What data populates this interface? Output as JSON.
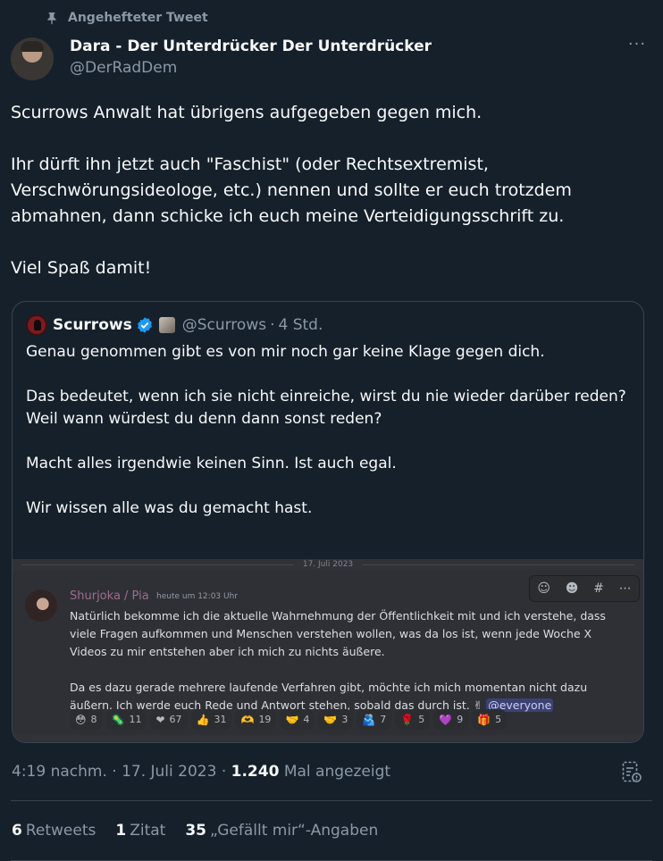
{
  "pinned_label": "Angehefteter Tweet",
  "author": {
    "name": "Dara - Der Unterdrücker Der Unterdrücker",
    "handle": "@DerRadDem"
  },
  "tweet_paragraphs": [
    "Scurrows Anwalt hat übrigens aufgegeben gegen mich.",
    "Ihr dürft ihn jetzt auch \"Faschist\" (oder Rechtsextremist, Verschwörungsideologe, etc.) nennen und sollte er euch trotzdem abmahnen, dann schicke ich euch meine Verteidigungsschrift zu.",
    "Viel Spaß damit!"
  ],
  "quote": {
    "name": "Scurrows",
    "handle": "@Scurrows",
    "separator": "·",
    "time": "4 Std.",
    "paragraphs": [
      "Genau genommen gibt es von mir noch gar keine Klage gegen dich.",
      "Das bedeutet, wenn ich sie nicht einreiche, wirst du nie wieder darüber reden? Weil wann würdest du denn dann sonst reden?",
      "Macht alles irgendwie keinen Sinn. Ist auch egal.",
      "Wir wissen alle was du gemacht hast."
    ],
    "image": {
      "date": "17. Juli 2023",
      "author": "Shurjoka / Pia",
      "timestamp": "heute um 12:03 Uhr",
      "paragraphs": [
        "Natürlich bekomme ich die aktuelle Wahrnehmung der Öffentlichkeit mit und ich verstehe, dass viele Fragen aufkommen und Menschen verstehen wollen, was da los ist, wenn jede Woche X Videos zu mir entstehen aber ich mich zu nichts äußere.",
        "Da es dazu gerade mehrere laufende Verfahren gibt, möchte ich mich momentan nicht dazu äußern. Ich werde euch Rede und Antwort stehen, sobald das durch ist. ✌"
      ],
      "mention": "@everyone",
      "reactions": [
        {
          "emoji": "😳",
          "count": "8"
        },
        {
          "emoji": "🦠",
          "count": "11"
        },
        {
          "emoji": "❤",
          "count": "67"
        },
        {
          "emoji": "👍",
          "count": "31"
        },
        {
          "emoji": "🫶",
          "count": "19"
        },
        {
          "emoji": "🤝",
          "count": "4"
        },
        {
          "emoji": "🤝",
          "count": "3"
        },
        {
          "emoji": "🫂",
          "count": "7"
        },
        {
          "emoji": "🌹",
          "count": "5"
        },
        {
          "emoji": "💜",
          "count": "9"
        },
        {
          "emoji": "🎁",
          "count": "5"
        }
      ]
    }
  },
  "meta": {
    "time": "4:19 nachm.",
    "dot": "·",
    "date": "17. Juli 2023",
    "views": "1.240",
    "views_label": "Mal angezeigt"
  },
  "stats": {
    "retweets_count": "6",
    "retweets_label": "Retweets",
    "quotes_count": "1",
    "quotes_label": "Zitat",
    "likes_count": "35",
    "likes_label": "„Gefällt mir“-Angaben"
  },
  "colors": {
    "background": "#15202b",
    "text": "#f7f9f9",
    "secondary": "#8b98a5",
    "border": "#38444d",
    "verified": "#1d9bf0"
  },
  "icons": [
    "pin-icon",
    "more-icon",
    "verified-icon",
    "analytics-icon"
  ]
}
